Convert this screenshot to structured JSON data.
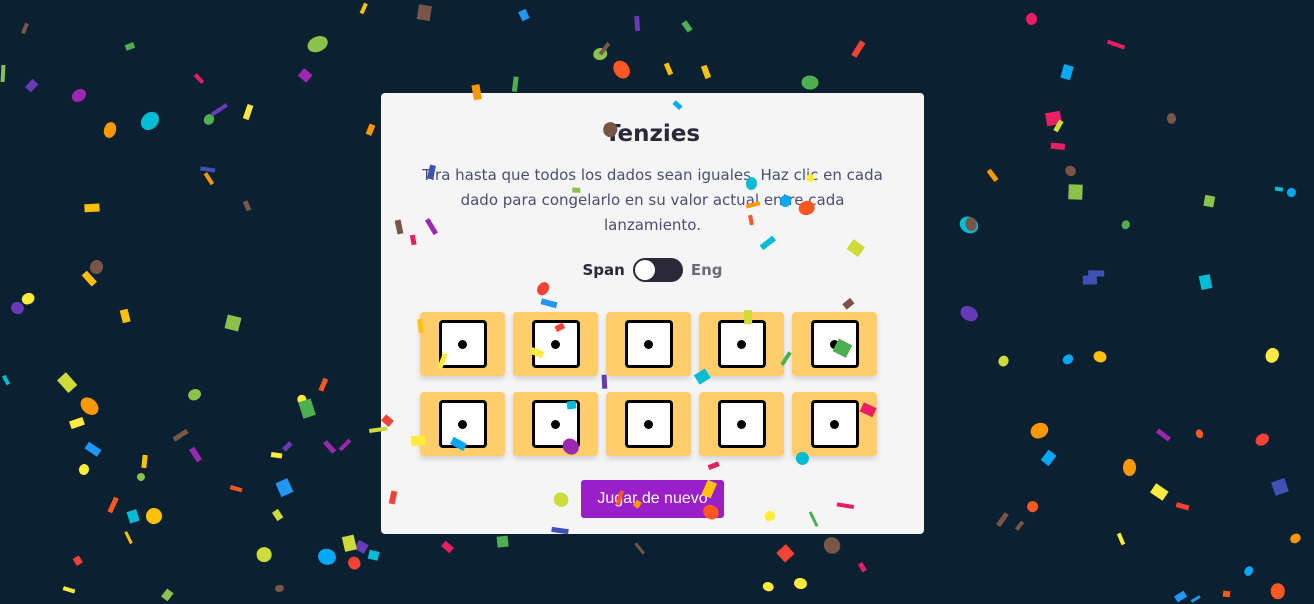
{
  "game": {
    "title": "Tenzies",
    "instructions": "Tira hasta que todos los dados sean iguales. Haz clic en cada dado para congelarlo en su valor actual entre cada lanzamiento.",
    "language_toggle": {
      "left_label": "Span",
      "right_label": "Eng",
      "selected": "Span"
    },
    "dice": [
      1,
      1,
      1,
      1,
      1,
      1,
      1,
      1,
      1,
      1
    ],
    "roll_button_label": "Jugar de nuevo",
    "won": true
  },
  "colors": {
    "background": "#0b2131",
    "card": "#f5f5f5",
    "die_held": "#ffcd6b",
    "button": "#9a1fc9",
    "confetti": [
      "#f44336",
      "#e91e63",
      "#9c27b0",
      "#673ab7",
      "#3f51b5",
      "#2196f3",
      "#03a9f4",
      "#00bcd4",
      "#8bc34a",
      "#4caf50",
      "#cddc39",
      "#ffeb3b",
      "#ffc107",
      "#ff9800",
      "#ff5722",
      "#795548"
    ]
  }
}
